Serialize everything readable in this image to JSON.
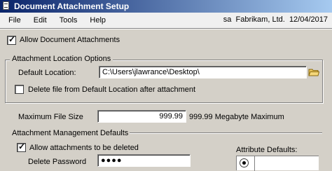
{
  "window": {
    "title": "Document Attachment Setup"
  },
  "menu": {
    "items": [
      "File",
      "Edit",
      "Tools",
      "Help"
    ]
  },
  "session": {
    "user": "sa",
    "company": "Fabrikam, Ltd.",
    "date": "12/04/2017"
  },
  "allow_attachments": {
    "label": "Allow Document Attachments",
    "checked": true
  },
  "location_group": {
    "title": "Attachment Location Options",
    "default_location_label": "Default Location:",
    "default_location_value": "C:\\Users\\jlawrance\\Desktop\\",
    "delete_after_label": "Delete file from Default Location after attachment",
    "delete_after_checked": false
  },
  "max_size": {
    "label": "Maximum File Size",
    "value": "999.99",
    "hint": "999.99 Megabyte Maximum"
  },
  "management": {
    "title": "Attachment Management Defaults",
    "allow_delete_label": "Allow attachments to be deleted",
    "allow_delete_checked": true,
    "password_label": "Delete Password",
    "password_value": "●●●●",
    "attribute_defaults_label": "Attribute Defaults:"
  },
  "icons": {
    "folder": "folder-icon",
    "window": "document-icon"
  }
}
